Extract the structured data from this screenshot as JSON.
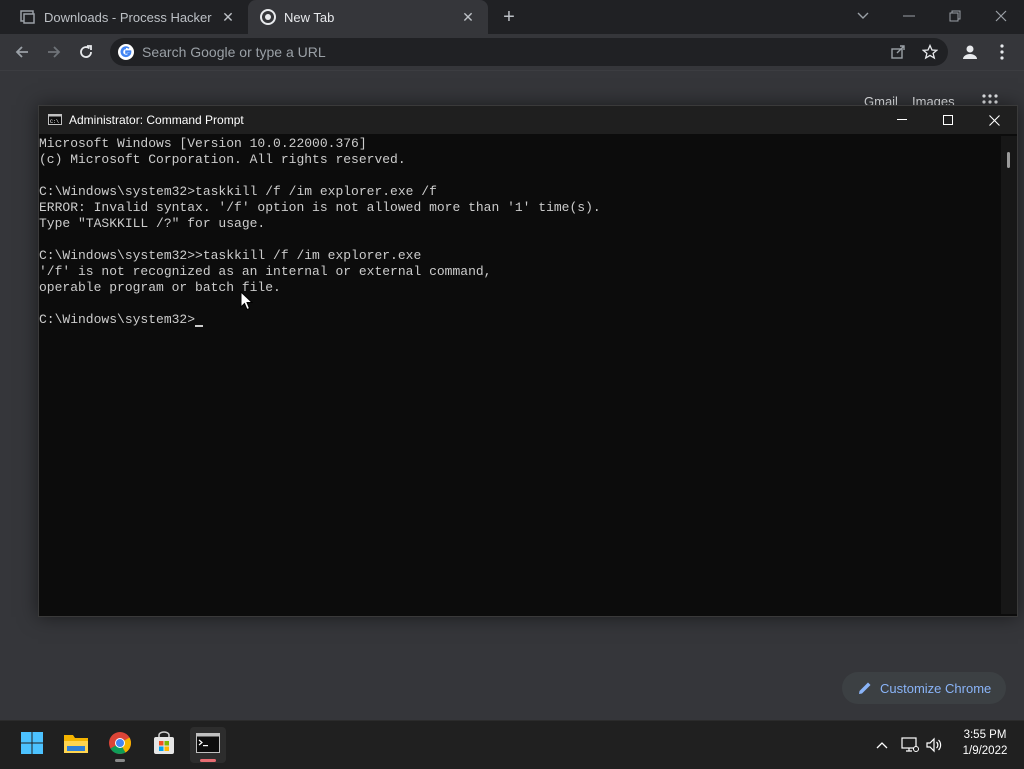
{
  "browser": {
    "tabs": [
      {
        "title": "Downloads - Process Hacker",
        "active": false
      },
      {
        "title": "New Tab",
        "active": true
      }
    ],
    "omnibox": {
      "placeholder": "Search Google or type a URL"
    },
    "ntp": {
      "links": [
        "Gmail",
        "Images"
      ],
      "customize_label": "Customize Chrome"
    }
  },
  "cmd_window": {
    "title": "Administrator: Command Prompt",
    "lines": [
      "Microsoft Windows [Version 10.0.22000.376]",
      "(c) Microsoft Corporation. All rights reserved.",
      "",
      "C:\\Windows\\system32>taskkill /f /im explorer.exe /f",
      "ERROR: Invalid syntax. '/f' option is not allowed more than '1' time(s).",
      "Type \"TASKKILL /?\" for usage.",
      "",
      "C:\\Windows\\system32>>taskkill /f /im explorer.exe",
      "'/f' is not recognized as an internal or external command,",
      "operable program or batch file.",
      "",
      "C:\\Windows\\system32>"
    ]
  },
  "taskbar": {
    "items": [
      "start-icon",
      "file-explorer-icon",
      "chrome-icon",
      "store-icon",
      "terminal-icon"
    ],
    "clock": {
      "time": "3:55 PM",
      "date": "1/9/2022"
    }
  },
  "colors": {
    "chrome_dark": "#202124",
    "chrome_toolbar": "#35363a",
    "console_bg": "#0c0c0c",
    "console_text": "#cccccc",
    "link_blue": "#8ab4f8"
  }
}
